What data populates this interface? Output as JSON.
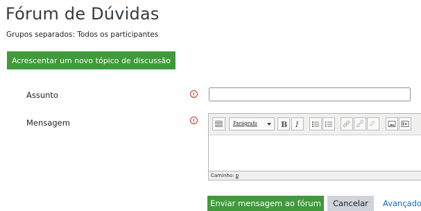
{
  "page": {
    "title": "Fórum de Dúvidas",
    "subtitle": "Grupos separados: Todos os participantes"
  },
  "actions": {
    "add_topic": "Acrescentar um novo tópico de discussão"
  },
  "form": {
    "subject_label": "Assunto",
    "subject_value": "",
    "message_label": "Mensagem",
    "required_icon": "exclamation-circle-icon"
  },
  "editor": {
    "format_select": "Parágrafo",
    "status_label": "Caminho:",
    "status_path": "p",
    "toolbar_icons": [
      "toggle-toolbar-icon",
      "bold-icon",
      "italic-icon",
      "bullet-list-icon",
      "numbered-list-icon",
      "link-icon",
      "unlink-icon",
      "anchor-icon",
      "image-icon",
      "media-icon"
    ]
  },
  "buttons": {
    "submit": "Enviar mensagem ao fórum",
    "cancel": "Cancelar",
    "advanced": "Avançado"
  },
  "colors": {
    "primary_green": "#3f9a3a",
    "required_red": "#ca3120",
    "link_blue": "#0f6cbf"
  }
}
